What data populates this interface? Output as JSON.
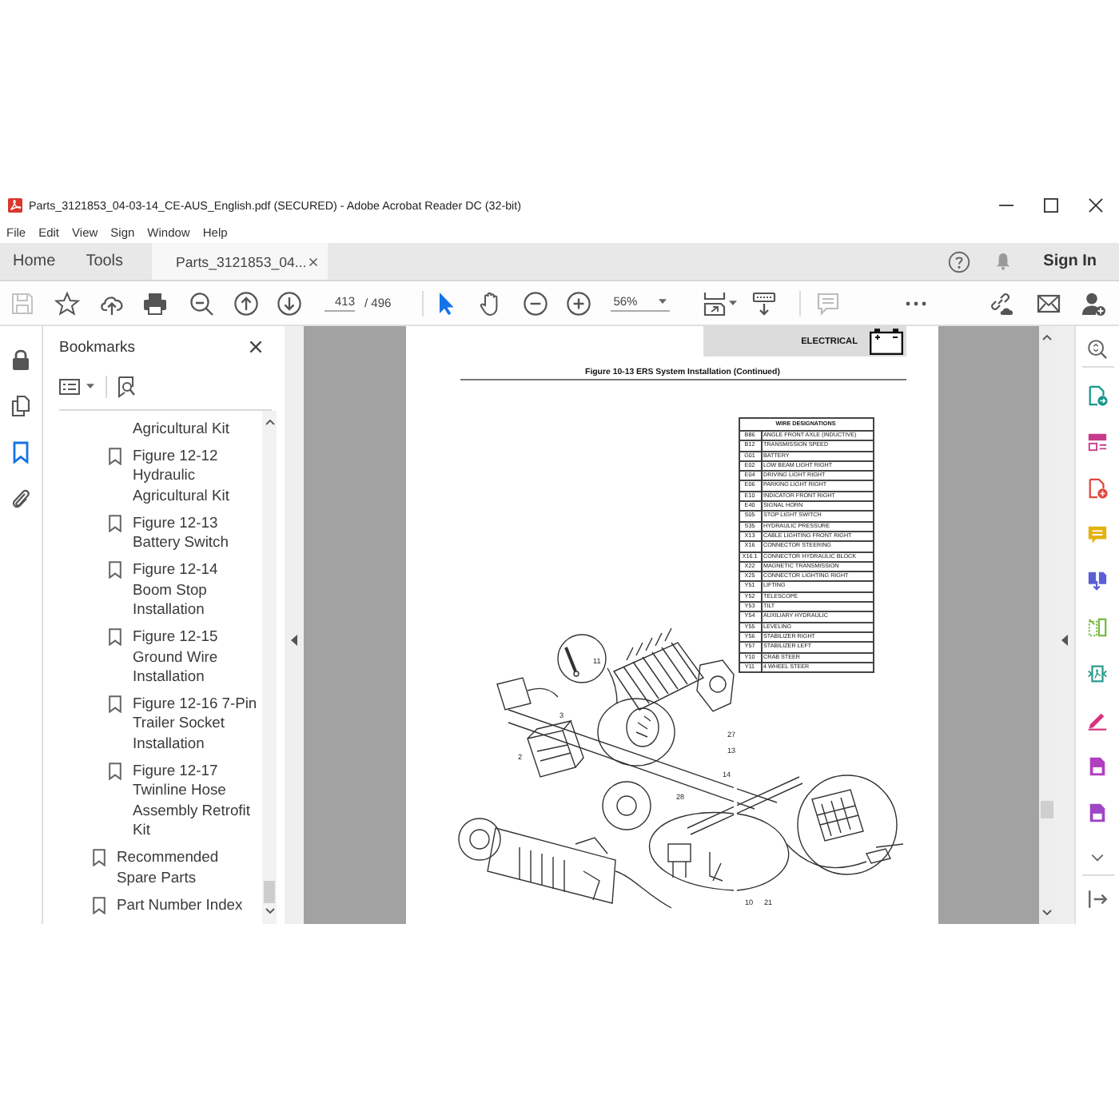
{
  "window": {
    "title": "Parts_3121853_04-03-14_CE-AUS_English.pdf (SECURED) - Adobe Acrobat Reader DC (32-bit)"
  },
  "menu": [
    "File",
    "Edit",
    "View",
    "Sign",
    "Window",
    "Help"
  ],
  "tabs": [
    {
      "label": "Home",
      "kind": "nav",
      "selected": false
    },
    {
      "label": "Tools",
      "kind": "nav",
      "selected": false
    },
    {
      "label": "Parts_3121853_04...",
      "kind": "document",
      "selected": true
    }
  ],
  "account": {
    "sign_in": "Sign In"
  },
  "toolbar": {
    "save": {
      "disabled": true
    },
    "page_number": "413",
    "page_count": "/ 496",
    "select_tool": {
      "selected": true
    },
    "hand_tool": {
      "selected": false
    },
    "zoom": "56%",
    "comment": {
      "disabled": true
    }
  },
  "nav_rail": [
    {
      "kind": "lock",
      "selected": false
    },
    {
      "kind": "pages",
      "selected": false
    },
    {
      "kind": "bookmarks",
      "selected": true
    },
    {
      "kind": "attachments",
      "selected": false
    }
  ],
  "bookmarks": {
    "title": "Bookmarks",
    "items": [
      {
        "children": [
          {
            "title": "Agricultural Kit",
            "kind": "cut"
          },
          {
            "title": "Figure 12-12 Hydraulic Agricultural Kit",
            "kind": "bookmark"
          },
          {
            "title": "Figure 12-13 Battery Switch",
            "kind": "bookmark"
          },
          {
            "title": "Figure 12-14 Boom Stop Installation",
            "kind": "bookmark"
          },
          {
            "title": "Figure 12-15 Ground Wire Installation",
            "kind": "bookmark"
          },
          {
            "title": "Figure 12-16 7-Pin Trailer Socket Installation",
            "kind": "bookmark"
          },
          {
            "title": "Figure 12-17 Twinline Hose Assembly Retrofit Kit",
            "kind": "bookmark"
          }
        ]
      },
      {
        "title": "Recommended Spare Parts",
        "kind": "bookmark"
      },
      {
        "title": "Part Number Index",
        "kind": "bookmark"
      }
    ]
  },
  "document": {
    "section": "ELECTRICAL",
    "figure_title": "Figure 10-13 ERS System Installation (Continued)",
    "table": {
      "title": "WIRE DESIGNATIONS",
      "rows": [
        [
          "B86",
          "ANGLE FRONT AXLE (INDUCTIVE)"
        ],
        [
          "B12",
          "TRANSMISSION SPEED"
        ],
        [
          "G01",
          "BATTERY"
        ],
        [
          "E02",
          "LOW BEAM LIGHT RIGHT"
        ],
        [
          "E04",
          "DRIVING LIGHT RIGHT"
        ],
        [
          "E06",
          "PARKING LIGHT RIGHT"
        ],
        [
          "E10",
          "INDICATOR FRONT RIGHT"
        ],
        [
          "E40",
          "SIGNAL HORN"
        ],
        [
          "S05",
          "STOP LIGHT SWITCH"
        ],
        [
          "S35",
          "HYDRAULIC PRESSURE"
        ],
        [
          "X13",
          "CABLE LIGHTING FRONT RIGHT"
        ],
        [
          "X16",
          "CONNECTOR STEERING"
        ],
        [
          "X16.1",
          "CONNECTOR HYDRAULIC BLOCK"
        ],
        [
          "X22",
          "MAGNETIC TRANSMISSION"
        ],
        [
          "X25",
          "CONNECTOR LIGHTING RIGHT"
        ],
        [
          "Y51",
          "LIFTING"
        ],
        [
          "Y52",
          "TELESCOPE"
        ],
        [
          "Y53",
          "TILT"
        ],
        [
          "Y54",
          "AUXILIARY HYDRAULIC"
        ],
        [
          "Y55",
          "LEVELING"
        ],
        [
          "Y56",
          "STABILIZER RIGHT"
        ],
        [
          "Y57",
          "STABILIZER LEFT"
        ],
        [
          "Y10",
          "CRAB STEER"
        ],
        [
          "Y11",
          "4 WHEEL STEER"
        ]
      ]
    },
    "callouts": [
      "11",
      "3",
      "2",
      "27",
      "13",
      "14",
      "28",
      "10",
      "21"
    ]
  }
}
